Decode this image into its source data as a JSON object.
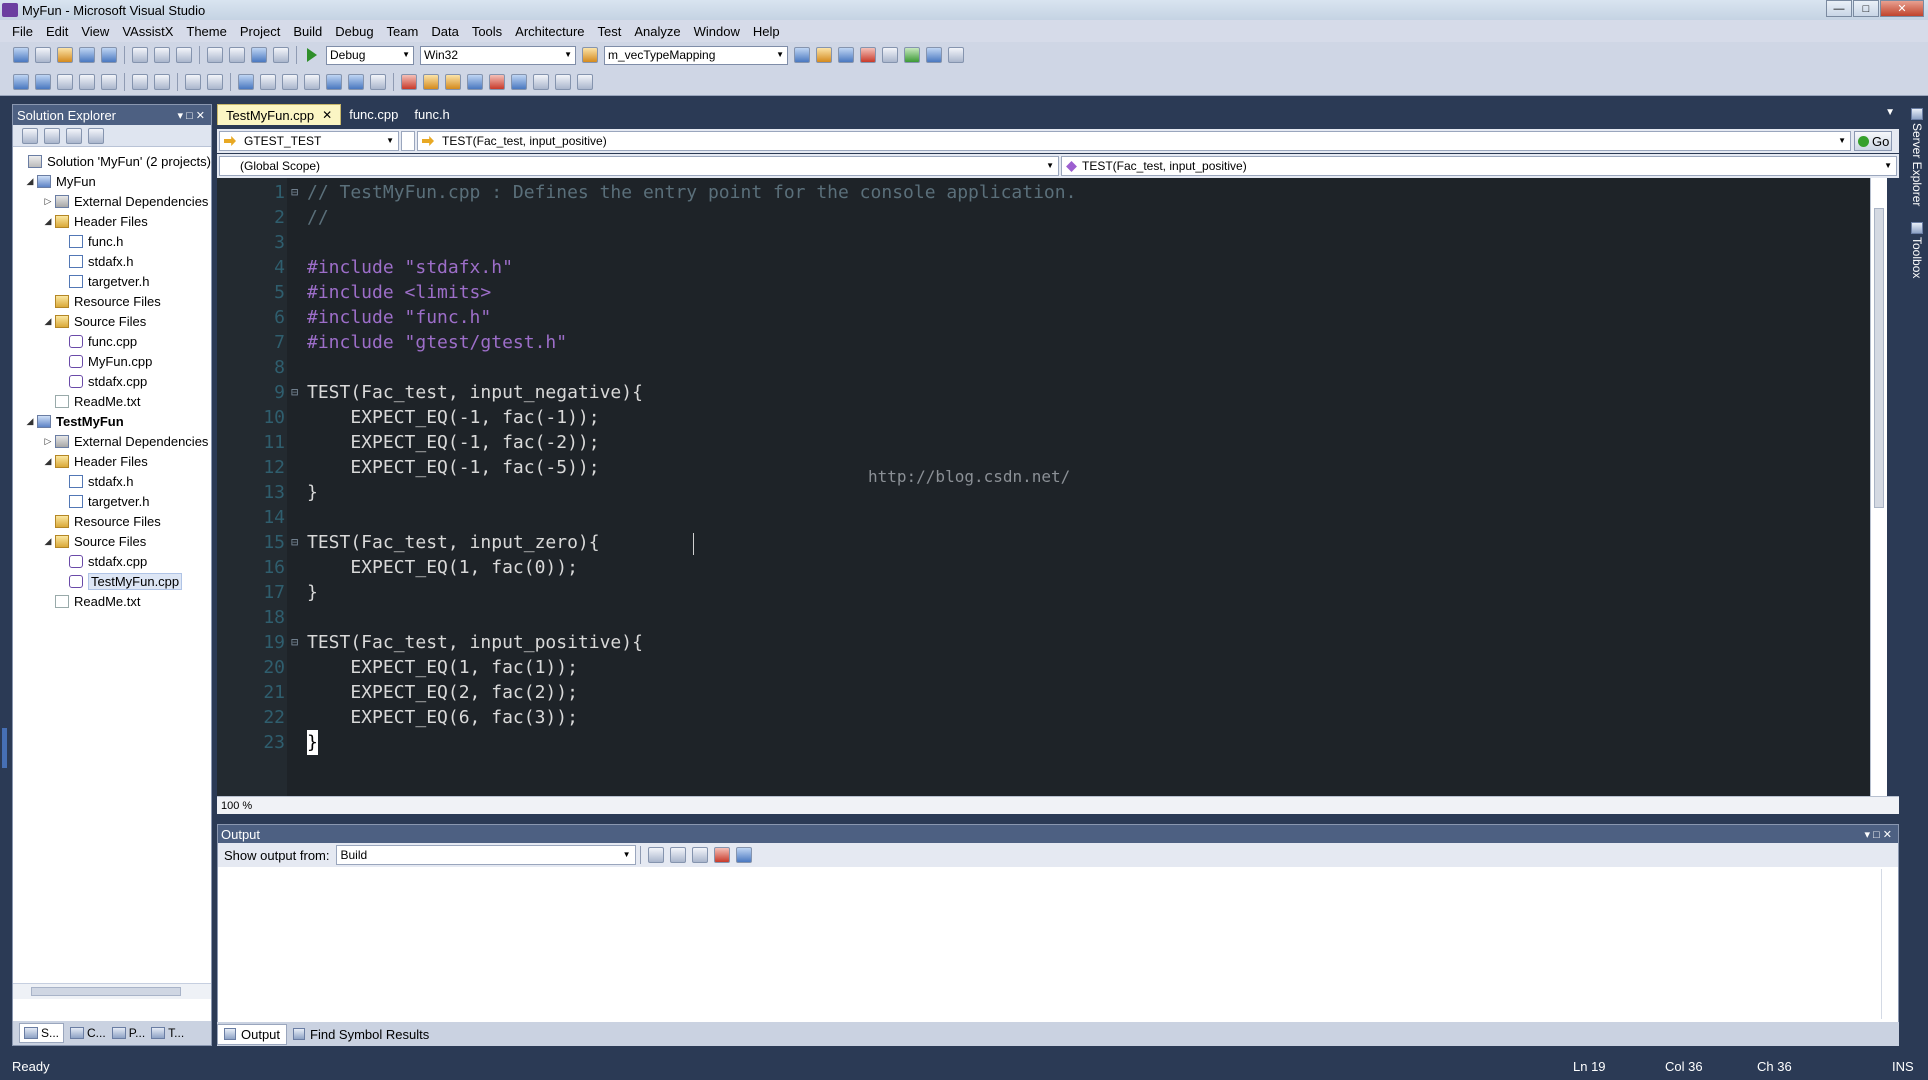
{
  "window": {
    "title": "MyFun - Microsoft Visual Studio"
  },
  "menu": [
    "File",
    "Edit",
    "View",
    "VAssistX",
    "Theme",
    "Project",
    "Build",
    "Debug",
    "Team",
    "Data",
    "Tools",
    "Architecture",
    "Test",
    "Analyze",
    "Window",
    "Help"
  ],
  "toolbar": {
    "config": "Debug",
    "platform": "Win32",
    "find_text": "m_vecTypeMapping"
  },
  "solution_explorer": {
    "title": "Solution Explorer",
    "rows": [
      {
        "label": "Solution 'MyFun' (2 projects)"
      },
      {
        "label": "MyFun"
      },
      {
        "label": "External Dependencies"
      },
      {
        "label": "Header Files"
      },
      {
        "label": "func.h"
      },
      {
        "label": "stdafx.h"
      },
      {
        "label": "targetver.h"
      },
      {
        "label": "Resource Files"
      },
      {
        "label": "Source Files"
      },
      {
        "label": "func.cpp"
      },
      {
        "label": "MyFun.cpp"
      },
      {
        "label": "stdafx.cpp"
      },
      {
        "label": "ReadMe.txt"
      },
      {
        "label": "TestMyFun"
      },
      {
        "label": "External Dependencies"
      },
      {
        "label": "Header Files"
      },
      {
        "label": "stdafx.h"
      },
      {
        "label": "targetver.h"
      },
      {
        "label": "Resource Files"
      },
      {
        "label": "Source Files"
      },
      {
        "label": "stdafx.cpp"
      },
      {
        "label": "TestMyFun.cpp"
      },
      {
        "label": "ReadMe.txt"
      }
    ],
    "bottom_tabs": [
      "S...",
      "C...",
      "P...",
      "T..."
    ]
  },
  "editor": {
    "tabs": [
      "TestMyFun.cpp",
      "func.cpp",
      "func.h"
    ],
    "class_combo": "GTEST_TEST",
    "member_combo": "TEST(Fac_test, input_positive)",
    "go_label": "Go",
    "scope_combo": "(Global Scope)",
    "scope_member_combo": "TEST(Fac_test, input_positive)",
    "zoom": "100 %",
    "watermark": "http://blog.csdn.net/",
    "lines": [
      {
        "n": "1",
        "text": "// TestMyFun.cpp : Defines the entry point for the console application."
      },
      {
        "n": "2",
        "text": "//"
      },
      {
        "n": "3",
        "text": ""
      },
      {
        "n": "4",
        "text": "#include \"stdafx.h\""
      },
      {
        "n": "5",
        "text": "#include <limits>"
      },
      {
        "n": "6",
        "text": "#include \"func.h\""
      },
      {
        "n": "7",
        "text": "#include \"gtest/gtest.h\""
      },
      {
        "n": "8",
        "text": ""
      },
      {
        "n": "9",
        "text": "TEST(Fac_test, input_negative){"
      },
      {
        "n": "10",
        "text": "    EXPECT_EQ(-1, fac(-1));"
      },
      {
        "n": "11",
        "text": "    EXPECT_EQ(-1, fac(-2));"
      },
      {
        "n": "12",
        "text": "    EXPECT_EQ(-1, fac(-5));"
      },
      {
        "n": "13",
        "text": "}"
      },
      {
        "n": "14",
        "text": ""
      },
      {
        "n": "15",
        "text": "TEST(Fac_test, input_zero){"
      },
      {
        "n": "16",
        "text": "    EXPECT_EQ(1, fac(0));"
      },
      {
        "n": "17",
        "text": "}"
      },
      {
        "n": "18",
        "text": ""
      },
      {
        "n": "19",
        "text": "TEST(Fac_test, input_positive){"
      },
      {
        "n": "20",
        "text": "    EXPECT_EQ(1, fac(1));"
      },
      {
        "n": "21",
        "text": "    EXPECT_EQ(2, fac(2));"
      },
      {
        "n": "22",
        "text": "    EXPECT_EQ(6, fac(3));"
      },
      {
        "n": "23",
        "text": "}"
      }
    ]
  },
  "output": {
    "title": "Output",
    "show_from_label": "Show output from:",
    "show_from_value": "Build",
    "tabs": [
      "Output",
      "Find Symbol Results"
    ]
  },
  "side_panels": [
    "Server Explorer",
    "Toolbox"
  ],
  "status": {
    "text": "Ready",
    "ln": "Ln 19",
    "col": "Col 36",
    "ch": "Ch 36",
    "mode": "INS"
  },
  "colors": {
    "editor_bg": "#1e2328",
    "comment": "#5a6f7a",
    "preprocessor": "#9d6ec9",
    "string": "#e0a040",
    "number": "#e8b830",
    "text": "#d9d9d9",
    "chrome": "#2b3a55"
  }
}
